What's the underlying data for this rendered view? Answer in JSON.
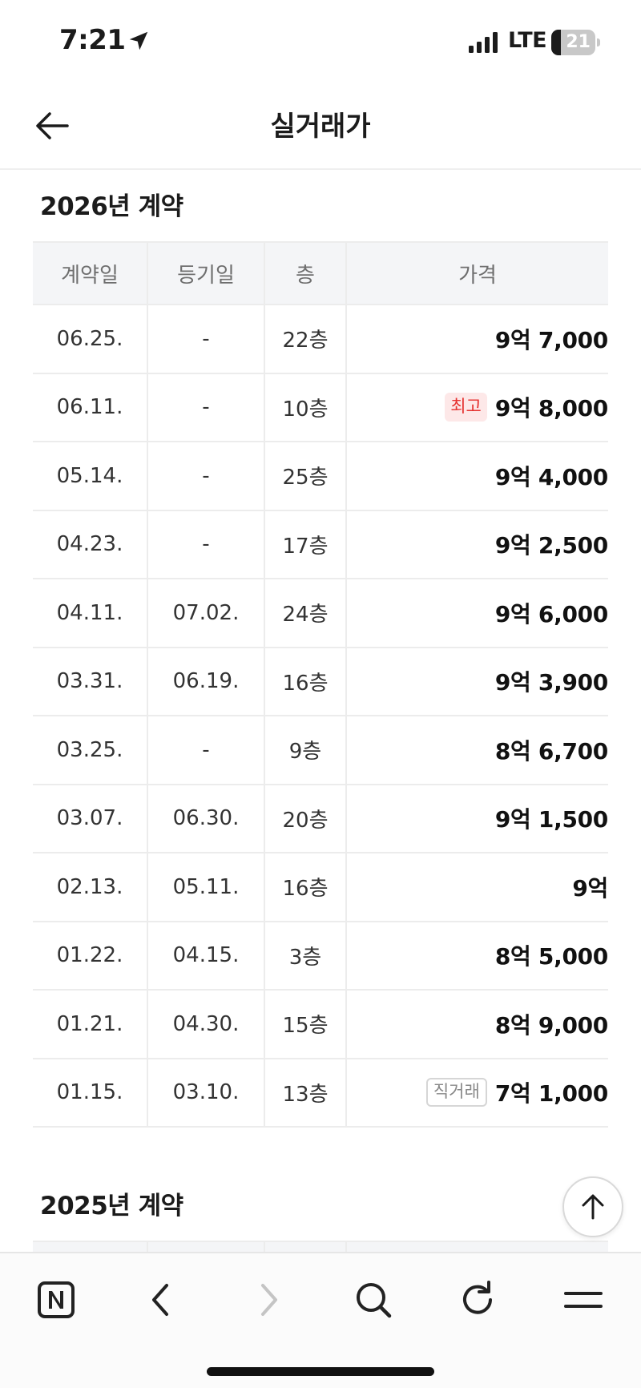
{
  "status_bar": {
    "time": "7:21",
    "network": "LTE",
    "battery": "21",
    "battery_fraction": 0.21
  },
  "header": {
    "title": "실거래가"
  },
  "sections": [
    {
      "title": "2026년 계약",
      "columns": [
        "계약일",
        "등기일",
        "층",
        "가격"
      ],
      "rows": [
        {
          "contract_date": "06.25.",
          "registration_date": "-",
          "floor": "22층",
          "price": "9억 7,000",
          "badge": ""
        },
        {
          "contract_date": "06.11.",
          "registration_date": "-",
          "floor": "10층",
          "price": "9억 8,000",
          "badge": "최고"
        },
        {
          "contract_date": "05.14.",
          "registration_date": "-",
          "floor": "25층",
          "price": "9억 4,000",
          "badge": ""
        },
        {
          "contract_date": "04.23.",
          "registration_date": "-",
          "floor": "17층",
          "price": "9억 2,500",
          "badge": ""
        },
        {
          "contract_date": "04.11.",
          "registration_date": "07.02.",
          "floor": "24층",
          "price": "9억 6,000",
          "badge": ""
        },
        {
          "contract_date": "03.31.",
          "registration_date": "06.19.",
          "floor": "16층",
          "price": "9억 3,900",
          "badge": ""
        },
        {
          "contract_date": "03.25.",
          "registration_date": "-",
          "floor": "9층",
          "price": "8억 6,700",
          "badge": ""
        },
        {
          "contract_date": "03.07.",
          "registration_date": "06.30.",
          "floor": "20층",
          "price": "9억 1,500",
          "badge": ""
        },
        {
          "contract_date": "02.13.",
          "registration_date": "05.11.",
          "floor": "16층",
          "price": "9억",
          "badge": ""
        },
        {
          "contract_date": "01.22.",
          "registration_date": "04.15.",
          "floor": "3층",
          "price": "8억 5,000",
          "badge": ""
        },
        {
          "contract_date": "01.21.",
          "registration_date": "04.30.",
          "floor": "15층",
          "price": "8억 9,000",
          "badge": ""
        },
        {
          "contract_date": "01.15.",
          "registration_date": "03.10.",
          "floor": "13층",
          "price": "7억 1,000",
          "badge": "직거래"
        }
      ]
    },
    {
      "title": "2025년 계약"
    }
  ],
  "badge_styles": {
    "최고": {
      "background": "#fde8e8",
      "color": "#e5312f"
    },
    "직거래": {
      "background": "#ffffff",
      "color": "#888888"
    }
  },
  "toolbar": {
    "icons": [
      "naver-home-icon",
      "chevron-left-icon",
      "chevron-right-icon",
      "search-icon",
      "refresh-icon",
      "menu-icon"
    ]
  },
  "colors": {
    "header_bg": "#f4f5f7",
    "border": "#ececec",
    "best_badge": "#e5312f"
  }
}
